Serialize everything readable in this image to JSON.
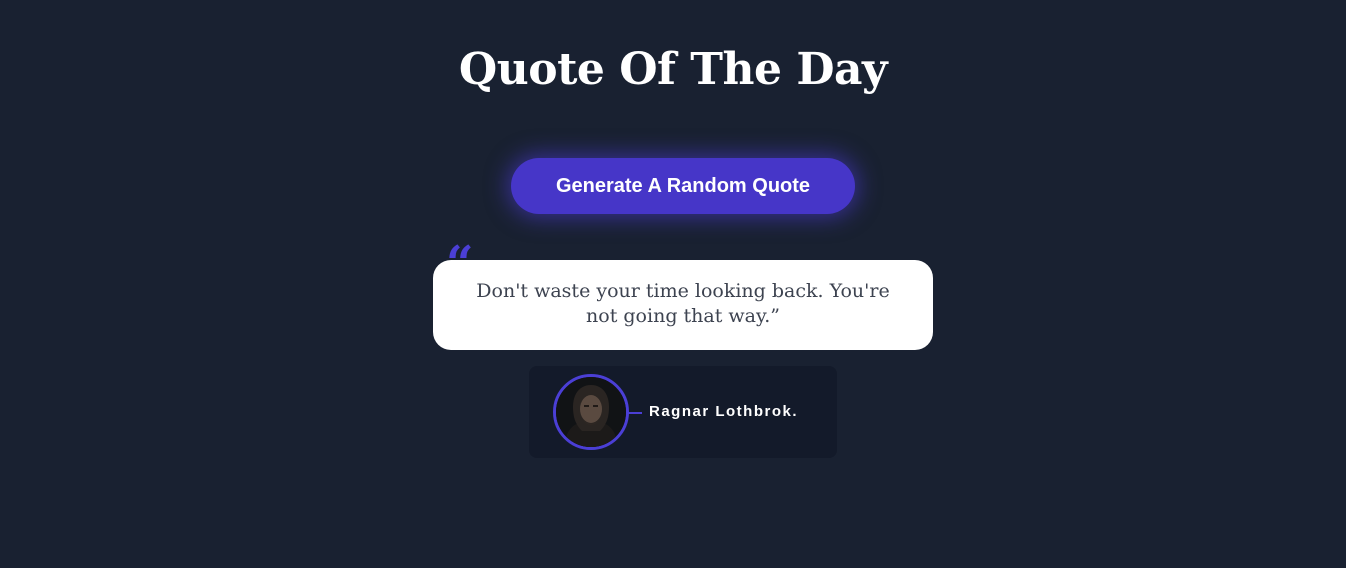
{
  "header": {
    "title": "Quote Of The Day"
  },
  "actions": {
    "generate_label": "Generate A Random Quote"
  },
  "quote": {
    "open_mark": "“",
    "text": "Don't waste your time looking back. You're not going that way.”"
  },
  "author": {
    "name": "Ragnar Lothbrok.",
    "avatar_icon": "portrait-photo"
  },
  "colors": {
    "background": "#192131",
    "accent": "#4636c8",
    "card": "#ffffff",
    "author_card": "#131a2a",
    "quote_text": "#3d4350"
  }
}
